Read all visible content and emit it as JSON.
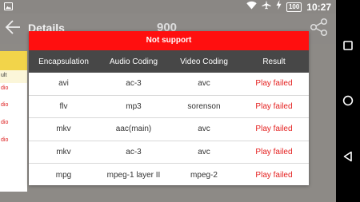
{
  "status_bar": {
    "time": "10:27",
    "battery": "100",
    "icons": [
      "gallery-icon",
      "wifi-icon",
      "airplane-icon",
      "charging-icon"
    ]
  },
  "toolbar": {
    "title": "Details",
    "center_text": "900"
  },
  "background_card": {
    "subheader_fragment": "ult",
    "rows": [
      "dio",
      "dio",
      "dio",
      "dio"
    ]
  },
  "dialog": {
    "title": "Not support",
    "columns": [
      "Encapsulation",
      "Audio Coding",
      "Video Coding",
      "Result"
    ],
    "rows": [
      [
        "avi",
        "ac-3",
        "avc",
        "Play failed"
      ],
      [
        "flv",
        "mp3",
        "sorenson",
        "Play failed"
      ],
      [
        "mkv",
        "aac(main)",
        "avc",
        "Play failed"
      ],
      [
        "mkv",
        "ac-3",
        "avc",
        "Play failed"
      ],
      [
        "mpg",
        "mpeg-1 layer II",
        "mpeg-2",
        "Play failed"
      ]
    ]
  },
  "colors": {
    "header_red": "#ff0f0f",
    "column_header_gray": "#474747",
    "result_red": "#e4201f",
    "card_yellow": "#f2d44a"
  },
  "navbar": {
    "buttons": [
      "recents-square-icon",
      "home-circle-icon",
      "back-triangle-icon"
    ]
  }
}
